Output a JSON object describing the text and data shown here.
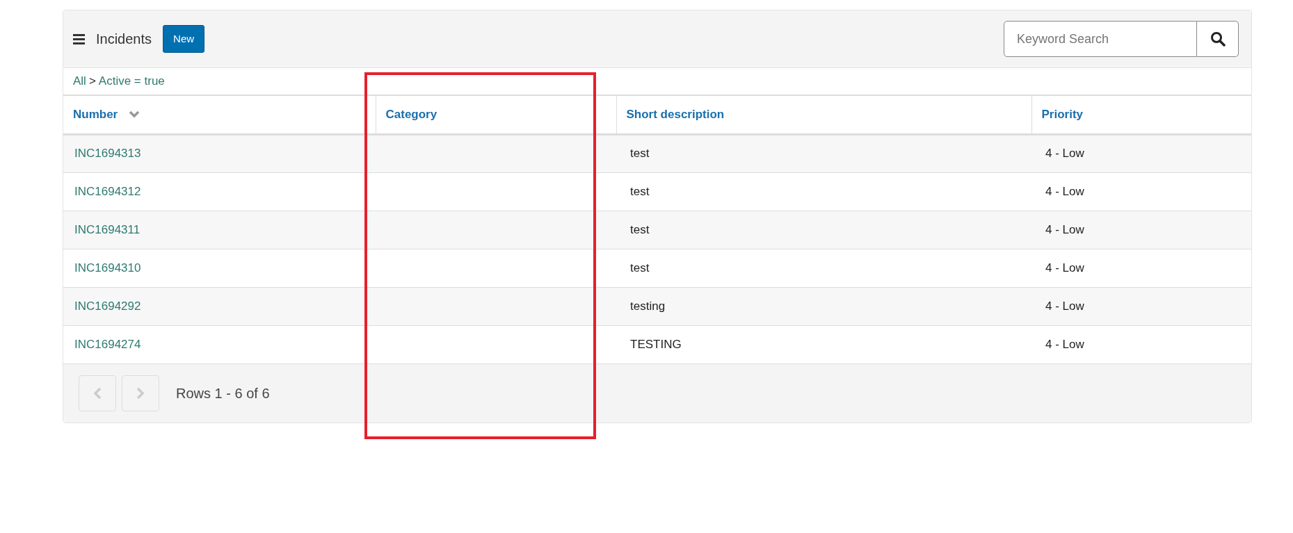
{
  "header": {
    "title": "Incidents",
    "new_button": "New",
    "search": {
      "placeholder": "Keyword Search"
    }
  },
  "breadcrumb": [
    {
      "label": "All"
    },
    {
      "label": "Active = true"
    }
  ],
  "breadcrumb_separator": ">",
  "table": {
    "columns": [
      {
        "label": "Number",
        "sorted": true
      },
      {
        "label": "Category",
        "sorted": false
      },
      {
        "label": "Short description",
        "sorted": false
      },
      {
        "label": "Priority",
        "sorted": false
      }
    ],
    "rows": [
      {
        "number": "INC1694313",
        "short_description": "test",
        "priority": "4 - Low"
      },
      {
        "number": "INC1694312",
        "short_description": "test",
        "priority": "4 - Low"
      },
      {
        "number": "INC1694311",
        "short_description": "test",
        "priority": "4 - Low"
      },
      {
        "number": "INC1694310",
        "short_description": "test",
        "priority": "4 - Low"
      },
      {
        "number": "INC1694292",
        "short_description": "testing",
        "priority": "4 - Low"
      },
      {
        "number": "INC1694274",
        "short_description": "TESTING",
        "priority": "4 - Low"
      }
    ]
  },
  "pagination": {
    "prev_disabled": true,
    "next_disabled": true,
    "summary": "Rows 1 - 6 of 6"
  },
  "annotations": [
    {
      "kind": "rectangle",
      "color": "#e81f2b"
    }
  ]
}
